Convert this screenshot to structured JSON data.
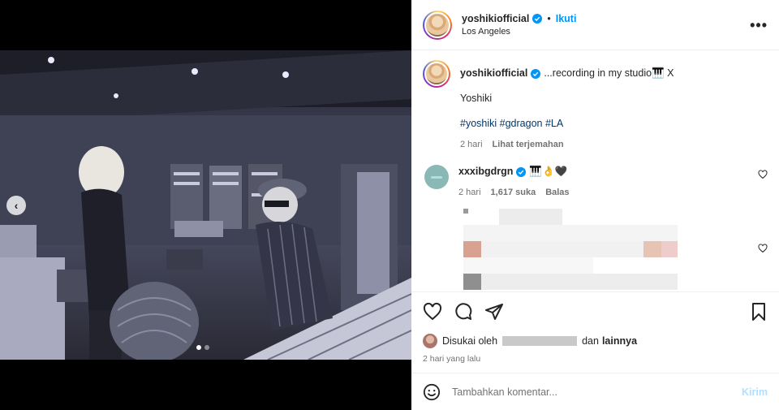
{
  "post": {
    "username": "yoshikiofficial",
    "follow_label": "Ikuti",
    "separator": "•",
    "location": "Los Angeles",
    "more_label": "•••"
  },
  "caption": {
    "username": "yoshikiofficial",
    "text": "...recording in my studio🎹 X",
    "line2": "Yoshiki",
    "hashtags": [
      "#yoshiki",
      "#gdragon",
      "#LA"
    ],
    "time": "2 hari",
    "translate_label": "Lihat terjemahan"
  },
  "comment": {
    "username": "xxxibgdrgn",
    "text": "🎹👌🖤",
    "time": "2 hari",
    "likes": "1,617 suka",
    "reply_label": "Balas"
  },
  "likes": {
    "prefix": "Disukai oleh",
    "suffix": "dan",
    "others": "lainnya"
  },
  "date": "2 hari yang lalu",
  "composer": {
    "placeholder": "Tambahkan komentar...",
    "post_label": "Kirim"
  },
  "carousel": {
    "prev_label": "‹",
    "dots": 2,
    "active": 1
  },
  "colors": {
    "accent": "#0095f6",
    "hashtag": "#00376b",
    "muted": "#737373"
  }
}
